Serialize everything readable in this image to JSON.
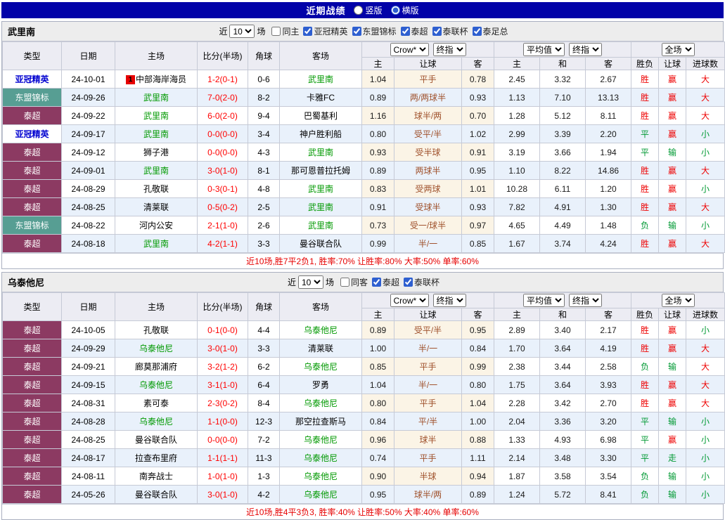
{
  "top_bar": {
    "title": "近期战绩",
    "options": [
      {
        "label": "竖版",
        "selected": false
      },
      {
        "label": "横版",
        "selected": true
      }
    ]
  },
  "colors": {
    "top_bar_bg": "#0202A8",
    "result_red": "#EE0000",
    "result_green": "#009933",
    "score_red": "#FF0000",
    "self_team_green": "#009900",
    "handicap_brown": "#A0522D",
    "type_acl_text": "#0000D0",
    "type_asean_bg": "#579E93",
    "type_thai_bg": "#8C3A62",
    "row_alt_bg": "#E9F1FB",
    "odds_tint_bg": "#FBF4E6",
    "header_bg": "#ECECF3"
  },
  "table_header": {
    "type": "类型",
    "date": "日期",
    "home": "主场",
    "score": "比分(半场)",
    "corner": "角球",
    "away": "客场",
    "odds_source": "Crow*",
    "odds_final": "终指",
    "avg_source": "平均值",
    "avg_final": "终指",
    "scope": "全场",
    "sub": [
      "主",
      "让球",
      "客",
      "主",
      "和",
      "客",
      "胜负",
      "让球",
      "进球数"
    ]
  },
  "sections": [
    {
      "team": "武里南",
      "filter": {
        "near": "近",
        "count": "10",
        "unit": "场",
        "same": {
          "label": "同主",
          "checked": false
        },
        "comps": [
          {
            "label": "亚冠精英",
            "checked": true
          },
          {
            "label": "东盟锦标",
            "checked": true
          },
          {
            "label": "泰超",
            "checked": true
          },
          {
            "label": "泰联杯",
            "checked": true
          },
          {
            "label": "泰足总",
            "checked": true
          }
        ]
      },
      "rows": [
        {
          "type": "亚冠精英",
          "typeKey": "acl",
          "date": "24-10-01",
          "home": "中部海岸海员",
          "homeBadge": "1",
          "homeSelf": false,
          "score": "1-2(0-1)",
          "corner": "0-6",
          "away": "武里南",
          "awaySelf": true,
          "oddsHome": "1.04",
          "handicap": "平手",
          "oddsAway": "0.78",
          "avgHome": "2.45",
          "avgDraw": "3.32",
          "avgAway": "2.67",
          "resWdl": "胜",
          "resWdlColor": "r",
          "resHcap": "赢",
          "resHcapColor": "r",
          "resGoals": "大",
          "resGoalsColor": "r"
        },
        {
          "type": "东盟锦标",
          "typeKey": "asean",
          "date": "24-09-26",
          "home": "武里南",
          "homeBadge": "",
          "homeSelf": true,
          "score": "7-0(2-0)",
          "corner": "8-2",
          "away": "卡雅FC",
          "awaySelf": false,
          "oddsHome": "0.89",
          "handicap": "两/两球半",
          "oddsAway": "0.93",
          "avgHome": "1.13",
          "avgDraw": "7.10",
          "avgAway": "13.13",
          "resWdl": "胜",
          "resWdlColor": "r",
          "resHcap": "赢",
          "resHcapColor": "r",
          "resGoals": "大",
          "resGoalsColor": "r"
        },
        {
          "type": "泰超",
          "typeKey": "thai",
          "date": "24-09-22",
          "home": "武里南",
          "homeBadge": "",
          "homeSelf": true,
          "score": "6-0(2-0)",
          "corner": "9-4",
          "away": "巴蜀基利",
          "awaySelf": false,
          "oddsHome": "1.16",
          "handicap": "球半/两",
          "oddsAway": "0.70",
          "avgHome": "1.28",
          "avgDraw": "5.12",
          "avgAway": "8.11",
          "resWdl": "胜",
          "resWdlColor": "r",
          "resHcap": "赢",
          "resHcapColor": "r",
          "resGoals": "大",
          "resGoalsColor": "r"
        },
        {
          "type": "亚冠精英",
          "typeKey": "acl",
          "date": "24-09-17",
          "home": "武里南",
          "homeBadge": "",
          "homeSelf": true,
          "score": "0-0(0-0)",
          "corner": "3-4",
          "away": "神户胜利船",
          "awaySelf": false,
          "oddsHome": "0.80",
          "handicap": "受平/半",
          "oddsAway": "1.02",
          "avgHome": "2.99",
          "avgDraw": "3.39",
          "avgAway": "2.20",
          "resWdl": "平",
          "resWdlColor": "g",
          "resHcap": "赢",
          "resHcapColor": "r",
          "resGoals": "小",
          "resGoalsColor": "g"
        },
        {
          "type": "泰超",
          "typeKey": "thai",
          "date": "24-09-12",
          "home": "狮子港",
          "homeBadge": "",
          "homeSelf": false,
          "score": "0-0(0-0)",
          "corner": "4-3",
          "away": "武里南",
          "awaySelf": true,
          "oddsHome": "0.93",
          "handicap": "受半球",
          "oddsAway": "0.91",
          "avgHome": "3.19",
          "avgDraw": "3.66",
          "avgAway": "1.94",
          "resWdl": "平",
          "resWdlColor": "g",
          "resHcap": "输",
          "resHcapColor": "g",
          "resGoals": "小",
          "resGoalsColor": "g"
        },
        {
          "type": "泰超",
          "typeKey": "thai",
          "date": "24-09-01",
          "home": "武里南",
          "homeBadge": "",
          "homeSelf": true,
          "score": "3-0(1-0)",
          "corner": "8-1",
          "away": "那可恩普拉托姆",
          "awaySelf": false,
          "oddsHome": "0.89",
          "handicap": "两球半",
          "oddsAway": "0.95",
          "avgHome": "1.10",
          "avgDraw": "8.22",
          "avgAway": "14.86",
          "resWdl": "胜",
          "resWdlColor": "r",
          "resHcap": "赢",
          "resHcapColor": "r",
          "resGoals": "大",
          "resGoalsColor": "r"
        },
        {
          "type": "泰超",
          "typeKey": "thai",
          "date": "24-08-29",
          "home": "孔敬联",
          "homeBadge": "",
          "homeSelf": false,
          "score": "0-3(0-1)",
          "corner": "4-8",
          "away": "武里南",
          "awaySelf": true,
          "oddsHome": "0.83",
          "handicap": "受两球",
          "oddsAway": "1.01",
          "avgHome": "10.28",
          "avgDraw": "6.11",
          "avgAway": "1.20",
          "resWdl": "胜",
          "resWdlColor": "r",
          "resHcap": "赢",
          "resHcapColor": "r",
          "resGoals": "小",
          "resGoalsColor": "g"
        },
        {
          "type": "泰超",
          "typeKey": "thai",
          "date": "24-08-25",
          "home": "清莱联",
          "homeBadge": "",
          "homeSelf": false,
          "score": "0-5(0-2)",
          "corner": "2-5",
          "away": "武里南",
          "awaySelf": true,
          "oddsHome": "0.91",
          "handicap": "受球半",
          "oddsAway": "0.93",
          "avgHome": "7.82",
          "avgDraw": "4.91",
          "avgAway": "1.30",
          "resWdl": "胜",
          "resWdlColor": "r",
          "resHcap": "赢",
          "resHcapColor": "r",
          "resGoals": "大",
          "resGoalsColor": "r"
        },
        {
          "type": "东盟锦标",
          "typeKey": "asean",
          "date": "24-08-22",
          "home": "河内公安",
          "homeBadge": "",
          "homeSelf": false,
          "score": "2-1(1-0)",
          "corner": "2-6",
          "away": "武里南",
          "awaySelf": true,
          "oddsHome": "0.73",
          "handicap": "受一/球半",
          "oddsAway": "0.97",
          "avgHome": "4.65",
          "avgDraw": "4.49",
          "avgAway": "1.48",
          "resWdl": "负",
          "resWdlColor": "g",
          "resHcap": "输",
          "resHcapColor": "g",
          "resGoals": "小",
          "resGoalsColor": "g"
        },
        {
          "type": "泰超",
          "typeKey": "thai",
          "date": "24-08-18",
          "home": "武里南",
          "homeBadge": "",
          "homeSelf": true,
          "score": "4-2(1-1)",
          "corner": "3-3",
          "away": "曼谷联合队",
          "awaySelf": false,
          "oddsHome": "0.99",
          "handicap": "半/一",
          "oddsAway": "0.85",
          "avgHome": "1.67",
          "avgDraw": "3.74",
          "avgAway": "4.24",
          "resWdl": "胜",
          "resWdlColor": "r",
          "resHcap": "赢",
          "resHcapColor": "r",
          "resGoals": "大",
          "resGoalsColor": "r"
        }
      ],
      "summary": "近10场,胜7平2负1, 胜率:70% 让胜率:80% 大率:50% 单率:60%"
    },
    {
      "team": "乌泰他尼",
      "filter": {
        "near": "近",
        "count": "10",
        "unit": "场",
        "same": {
          "label": "同客",
          "checked": false
        },
        "comps": [
          {
            "label": "泰超",
            "checked": true
          },
          {
            "label": "泰联杯",
            "checked": true
          }
        ]
      },
      "rows": [
        {
          "type": "泰超",
          "typeKey": "thai",
          "date": "24-10-05",
          "home": "孔敬联",
          "homeBadge": "",
          "homeSelf": false,
          "score": "0-1(0-0)",
          "corner": "4-4",
          "away": "乌泰他尼",
          "awaySelf": true,
          "oddsHome": "0.89",
          "handicap": "受平/半",
          "oddsAway": "0.95",
          "avgHome": "2.89",
          "avgDraw": "3.40",
          "avgAway": "2.17",
          "resWdl": "胜",
          "resWdlColor": "r",
          "resHcap": "赢",
          "resHcapColor": "r",
          "resGoals": "小",
          "resGoalsColor": "g"
        },
        {
          "type": "泰超",
          "typeKey": "thai",
          "date": "24-09-29",
          "home": "乌泰他尼",
          "homeBadge": "",
          "homeSelf": true,
          "score": "3-0(1-0)",
          "corner": "3-3",
          "away": "清莱联",
          "awaySelf": false,
          "oddsHome": "1.00",
          "handicap": "半/一",
          "oddsAway": "0.84",
          "avgHome": "1.70",
          "avgDraw": "3.64",
          "avgAway": "4.19",
          "resWdl": "胜",
          "resWdlColor": "r",
          "resHcap": "赢",
          "resHcapColor": "r",
          "resGoals": "大",
          "resGoalsColor": "r"
        },
        {
          "type": "泰超",
          "typeKey": "thai",
          "date": "24-09-21",
          "home": "廊莫那浦府",
          "homeBadge": "",
          "homeSelf": false,
          "score": "3-2(1-2)",
          "corner": "6-2",
          "away": "乌泰他尼",
          "awaySelf": true,
          "oddsHome": "0.85",
          "handicap": "平手",
          "oddsAway": "0.99",
          "avgHome": "2.38",
          "avgDraw": "3.44",
          "avgAway": "2.58",
          "resWdl": "负",
          "resWdlColor": "g",
          "resHcap": "输",
          "resHcapColor": "g",
          "resGoals": "大",
          "resGoalsColor": "r"
        },
        {
          "type": "泰超",
          "typeKey": "thai",
          "date": "24-09-15",
          "home": "乌泰他尼",
          "homeBadge": "",
          "homeSelf": true,
          "score": "3-1(1-0)",
          "corner": "6-4",
          "away": "罗勇",
          "awaySelf": false,
          "oddsHome": "1.04",
          "handicap": "半/一",
          "oddsAway": "0.80",
          "avgHome": "1.75",
          "avgDraw": "3.64",
          "avgAway": "3.93",
          "resWdl": "胜",
          "resWdlColor": "r",
          "resHcap": "赢",
          "resHcapColor": "r",
          "resGoals": "大",
          "resGoalsColor": "r"
        },
        {
          "type": "泰超",
          "typeKey": "thai",
          "date": "24-08-31",
          "home": "素可泰",
          "homeBadge": "",
          "homeSelf": false,
          "score": "2-3(0-2)",
          "corner": "8-4",
          "away": "乌泰他尼",
          "awaySelf": true,
          "oddsHome": "0.80",
          "handicap": "平手",
          "oddsAway": "1.04",
          "avgHome": "2.28",
          "avgDraw": "3.42",
          "avgAway": "2.70",
          "resWdl": "胜",
          "resWdlColor": "r",
          "resHcap": "赢",
          "resHcapColor": "r",
          "resGoals": "大",
          "resGoalsColor": "r"
        },
        {
          "type": "泰超",
          "typeKey": "thai",
          "date": "24-08-28",
          "home": "乌泰他尼",
          "homeBadge": "",
          "homeSelf": true,
          "score": "1-1(0-0)",
          "corner": "12-3",
          "away": "那空拉查斯马",
          "awaySelf": false,
          "oddsHome": "0.84",
          "handicap": "平/半",
          "oddsAway": "1.00",
          "avgHome": "2.04",
          "avgDraw": "3.36",
          "avgAway": "3.20",
          "resWdl": "平",
          "resWdlColor": "g",
          "resHcap": "输",
          "resHcapColor": "g",
          "resGoals": "小",
          "resGoalsColor": "g"
        },
        {
          "type": "泰超",
          "typeKey": "thai",
          "date": "24-08-25",
          "home": "曼谷联合队",
          "homeBadge": "",
          "homeSelf": false,
          "score": "0-0(0-0)",
          "corner": "7-2",
          "away": "乌泰他尼",
          "awaySelf": true,
          "oddsHome": "0.96",
          "handicap": "球半",
          "oddsAway": "0.88",
          "avgHome": "1.33",
          "avgDraw": "4.93",
          "avgAway": "6.98",
          "resWdl": "平",
          "resWdlColor": "g",
          "resHcap": "赢",
          "resHcapColor": "r",
          "resGoals": "小",
          "resGoalsColor": "g"
        },
        {
          "type": "泰超",
          "typeKey": "thai",
          "date": "24-08-17",
          "home": "拉查布里府",
          "homeBadge": "",
          "homeSelf": false,
          "score": "1-1(1-1)",
          "corner": "11-3",
          "away": "乌泰他尼",
          "awaySelf": true,
          "oddsHome": "0.74",
          "handicap": "平手",
          "oddsAway": "1.11",
          "avgHome": "2.14",
          "avgDraw": "3.48",
          "avgAway": "3.30",
          "resWdl": "平",
          "resWdlColor": "g",
          "resHcap": "走",
          "resHcapColor": "g",
          "resGoals": "小",
          "resGoalsColor": "g"
        },
        {
          "type": "泰超",
          "typeKey": "thai",
          "date": "24-08-11",
          "home": "南奔战士",
          "homeBadge": "",
          "homeSelf": false,
          "score": "1-0(1-0)",
          "corner": "1-3",
          "away": "乌泰他尼",
          "awaySelf": true,
          "oddsHome": "0.90",
          "handicap": "半球",
          "oddsAway": "0.94",
          "avgHome": "1.87",
          "avgDraw": "3.58",
          "avgAway": "3.54",
          "resWdl": "负",
          "resWdlColor": "g",
          "resHcap": "输",
          "resHcapColor": "g",
          "resGoals": "小",
          "resGoalsColor": "g"
        },
        {
          "type": "泰超",
          "typeKey": "thai",
          "date": "24-05-26",
          "home": "曼谷联合队",
          "homeBadge": "",
          "homeSelf": false,
          "score": "3-0(1-0)",
          "corner": "4-2",
          "away": "乌泰他尼",
          "awaySelf": true,
          "oddsHome": "0.95",
          "handicap": "球半/两",
          "oddsAway": "0.89",
          "avgHome": "1.24",
          "avgDraw": "5.72",
          "avgAway": "8.41",
          "resWdl": "负",
          "resWdlColor": "g",
          "resHcap": "输",
          "resHcapColor": "g",
          "resGoals": "小",
          "resGoalsColor": "g"
        }
      ],
      "summary": "近10场,胜4平3负3, 胜率:40% 让胜率:50% 大率:40% 单率:60%"
    }
  ]
}
